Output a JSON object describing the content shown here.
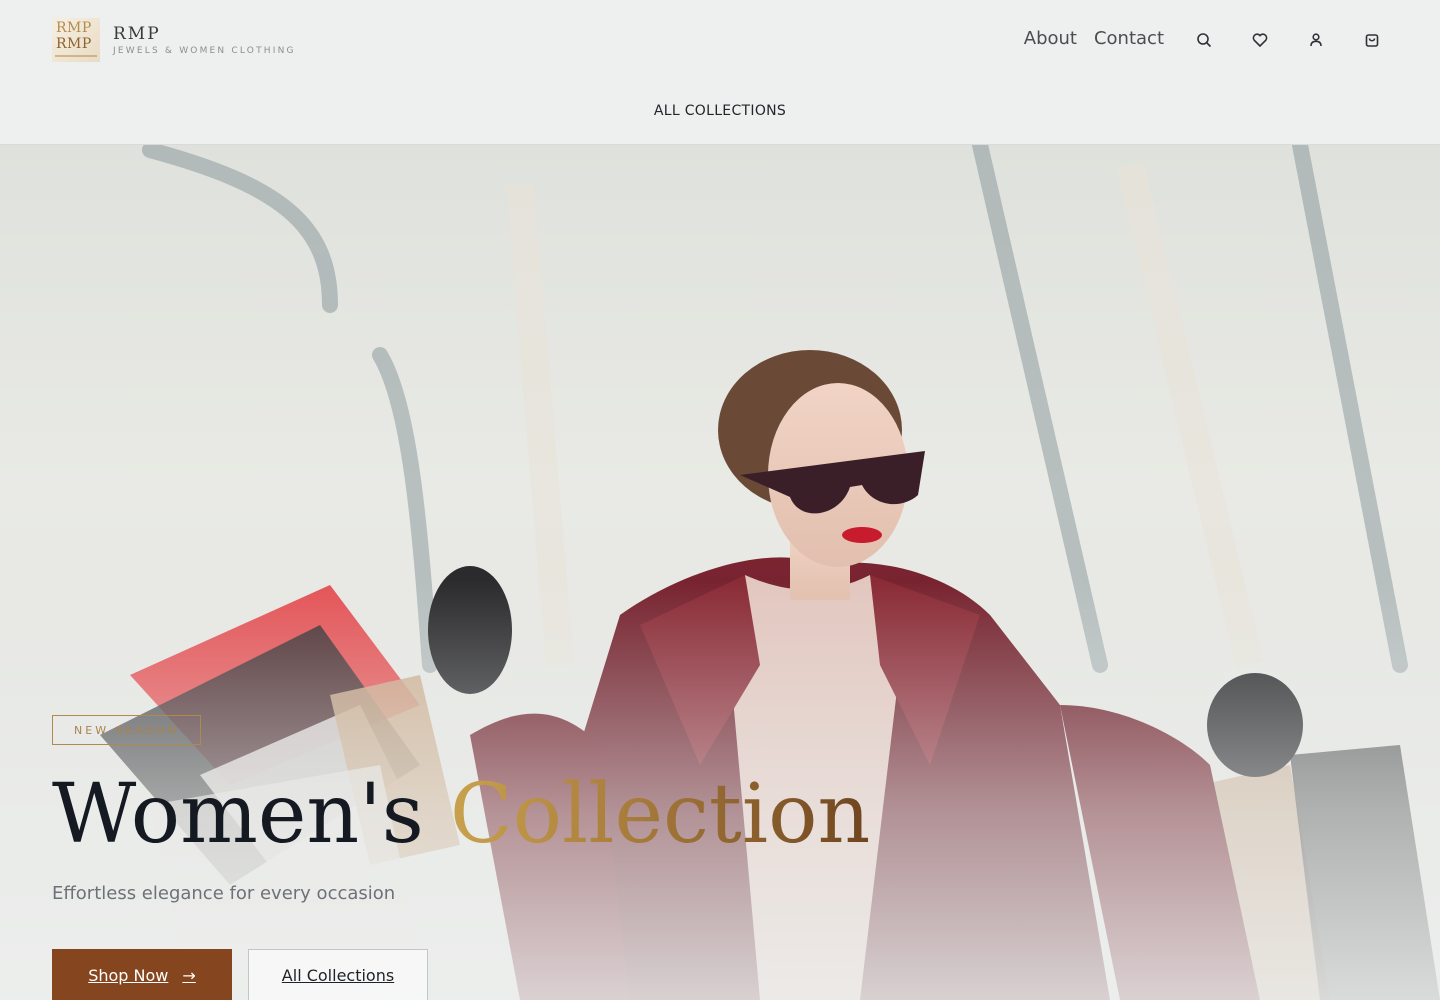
{
  "brand": {
    "logo_text": "RMP",
    "name": "RMP",
    "tagline": "JEWELS & WOMEN CLOTHING"
  },
  "nav": {
    "about": "About",
    "contact": "Contact",
    "sub": "ALL COLLECTIONS"
  },
  "icons": [
    "search-icon",
    "heart-icon",
    "user-icon",
    "bag-icon"
  ],
  "hero": {
    "badge": "NEW SEASON",
    "title_main": "Women's",
    "title_accent": "Collection",
    "subtitle": "Effortless elegance for every occasion",
    "cta_primary": "Shop Now",
    "cta_secondary": "All Collections"
  },
  "colors": {
    "accent_gold": "#b08a4c",
    "primary_brown": "#84451f",
    "header_bg": "#eef0ef"
  }
}
